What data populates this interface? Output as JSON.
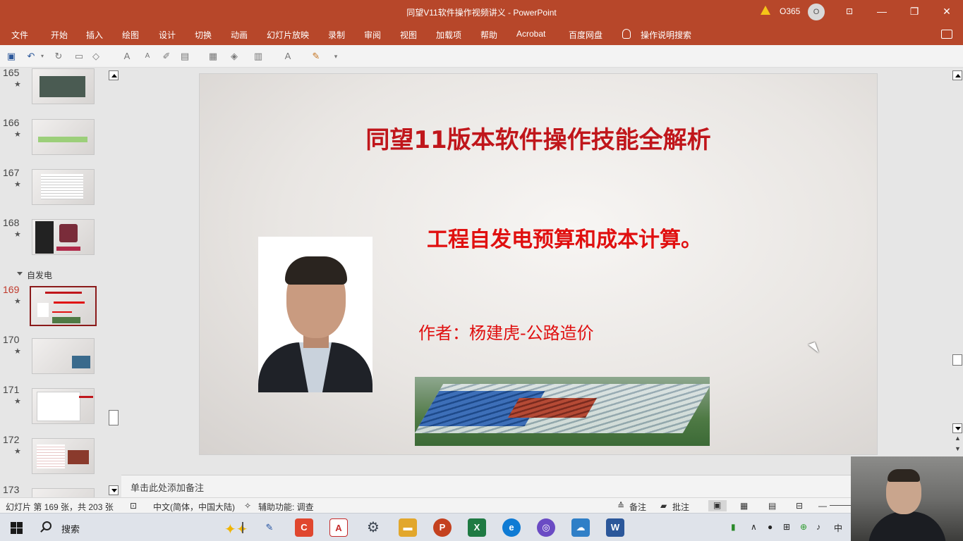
{
  "window": {
    "title": "同望V11软件操作视频讲义  -  PowerPoint",
    "user": "O365",
    "avatar_initial": "O",
    "minimize": "—",
    "restore": "❐",
    "close": "✕",
    "ribbon_display": "⊡"
  },
  "menu": {
    "tabs": [
      "文件",
      "开始",
      "插入",
      "绘图",
      "设计",
      "切换",
      "动画",
      "幻灯片放映",
      "录制",
      "审阅",
      "视图",
      "加载项",
      "帮助",
      "Acrobat",
      "百度网盘"
    ],
    "tell_me": "操作说明搜索"
  },
  "quick_access": {
    "icons": [
      "save-icon",
      "undo-icon",
      "redo-icon",
      "start-from-beginning-icon",
      "shape-icon",
      "font-grow-icon",
      "font-shrink-icon",
      "clear-format-icon",
      "layout-icon",
      "table-borders-icon",
      "shape-fill-icon",
      "table-icon",
      "font-color-icon",
      "format-painter-icon",
      "customize-icon"
    ]
  },
  "thumbnails": {
    "section_name": "自发电",
    "items": [
      {
        "num": "165",
        "star": "★"
      },
      {
        "num": "166",
        "star": "★"
      },
      {
        "num": "167",
        "star": "★"
      },
      {
        "num": "168",
        "star": "★"
      },
      {
        "num": "169",
        "star": "★",
        "active": true
      },
      {
        "num": "170",
        "star": "★"
      },
      {
        "num": "171",
        "star": "★"
      },
      {
        "num": "172",
        "star": "★"
      },
      {
        "num": "173",
        "star": ""
      }
    ]
  },
  "slide": {
    "title": "同望11版本软件操作技能全解析",
    "subtitle": "工程自发电预算和成本计算。",
    "author": "作者：杨建虎-公路造价"
  },
  "notes": {
    "placeholder": "单击此处添加备注"
  },
  "status_bar": {
    "slide_info": "幻灯片 第 169 张，共 203 张",
    "language": "中文(简体，中国大陆)",
    "accessibility": "辅助功能: 调查",
    "notes_btn": "备注",
    "comments_btn": "批注",
    "zoom_minus": "—"
  },
  "taskbar": {
    "search_label": "搜索",
    "apps": [
      {
        "name": "file-explorer-brush-icon",
        "glyph": "✎",
        "color": "#1f4fa0"
      },
      {
        "name": "c-app-icon",
        "glyph": "C",
        "color": "#e0472f"
      },
      {
        "name": "acrobat-icon",
        "glyph": "A",
        "color": "#c62b2b"
      },
      {
        "name": "settings-icon",
        "glyph": "⚙",
        "color": "#3d4652"
      },
      {
        "name": "folder-icon",
        "glyph": "▬",
        "color": "#e2a72c"
      },
      {
        "name": "powerpoint-icon",
        "glyph": "P",
        "color": "#c4411f"
      },
      {
        "name": "excel-icon",
        "glyph": "X",
        "color": "#1f7a43"
      },
      {
        "name": "edge-icon",
        "glyph": "e",
        "color": "#0f7bd4"
      },
      {
        "name": "browser-icon",
        "glyph": "◎",
        "color": "#6a4bc4"
      },
      {
        "name": "network-app-icon",
        "glyph": "☁",
        "color": "#2f7fc7"
      },
      {
        "name": "word-icon",
        "glyph": "W",
        "color": "#2b579a"
      }
    ],
    "tray_ime": "中"
  }
}
